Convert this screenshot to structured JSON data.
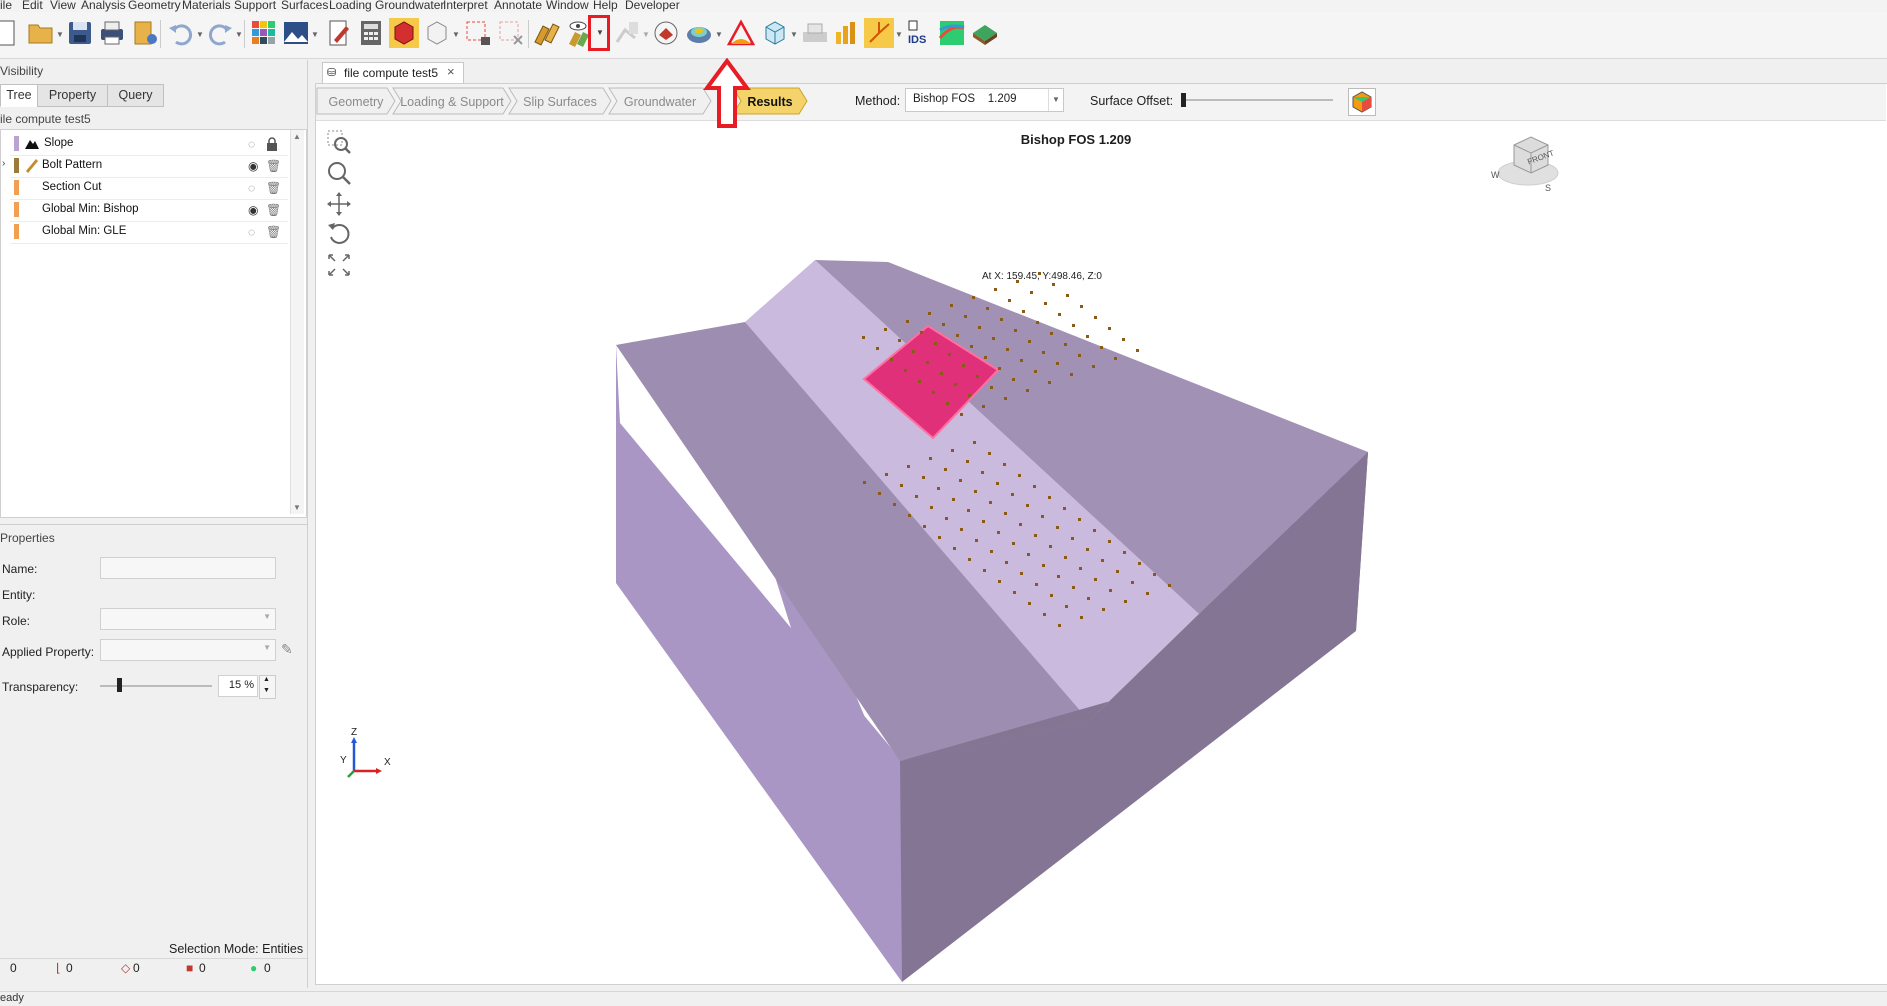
{
  "menu": [
    "ile",
    "Edit",
    "View",
    "Analysis",
    "Geometry",
    "Materials",
    "Support",
    "Surfaces",
    "Loading",
    "Groundwater",
    "Interpret",
    "Annotate",
    "Window",
    "Help",
    "Developer"
  ],
  "toolbar_icons": [
    "new-file-icon",
    "open-folder-icon",
    "save-icon",
    "print-icon",
    "export-icon",
    "undo-icon",
    "redo-icon",
    "grid-view-icon",
    "image-icon",
    "edit-icon",
    "calculator-icon",
    "solid-box-icon",
    "wire-box-icon",
    "lock-select-icon",
    "deselect-icon",
    "bolt-pattern-icon",
    "visibility-toggle-icon",
    "dropdown-arrow-icon",
    "disabled-bolt-icon",
    "section-icon",
    "contour-icon",
    "slice-icon",
    "cube-view-icon",
    "support-icon",
    "chart-icon",
    "axis-icon",
    "ids-icon",
    "contour-map-icon",
    "surface-icon"
  ],
  "left": {
    "visibility_title": "Visibility",
    "tabs": [
      "Tree",
      "Property",
      "Query"
    ],
    "model_name": "ile compute test5",
    "tree_items": [
      {
        "label": "Slope",
        "color": "#b8a3d1",
        "icon": "slope-icon",
        "visible": false,
        "lock": true
      },
      {
        "label": "Bolt Pattern",
        "color": "#9b7a3a",
        "icon": "bolt-icon",
        "visible": true,
        "expand": true
      },
      {
        "label": "Section Cut",
        "color": "#f0a050",
        "visible": false
      },
      {
        "label": "Global Min: Bishop",
        "color": "#f0a050",
        "visible": true
      },
      {
        "label": "Global Min: GLE",
        "color": "#f0a050",
        "visible": false
      }
    ],
    "properties_title": "Properties",
    "name_label": "Name:",
    "entity_label": "Entity:",
    "role_label": "Role:",
    "applied_property_label": "Applied Property:",
    "transparency_label": "Transparency:",
    "transparency_value": "15 %",
    "selection_mode": "Selection Mode: Entities",
    "counters": [
      "0",
      "0",
      "0",
      "0",
      "0"
    ]
  },
  "doc": {
    "tab_title": "file compute test5",
    "workflow_steps": [
      "Geometry",
      "Loading & Support",
      "Slip Surfaces",
      "Groundwater",
      "Results"
    ],
    "active_step": "Results",
    "method_label": "Method:",
    "method_value": "Bishop FOS    1.209",
    "surface_offset_label": "Surface Offset:",
    "view_title": "Bishop FOS 1.209",
    "cursor_readout": "At X: 159.45, Y:498.46, Z:0",
    "viewcube_label": "FRONT",
    "compass": [
      "W",
      "S"
    ],
    "axes": [
      "Z",
      "X",
      "Y"
    ]
  },
  "status": {
    "text": "eady"
  },
  "colors": {
    "highlight": "#e81c24",
    "active_step": "#f4d46a",
    "slip_surface": "#e0307a",
    "slope_top": "#a08fb4",
    "slope_face": "#c8b7dc",
    "slope_side": "#847592"
  }
}
